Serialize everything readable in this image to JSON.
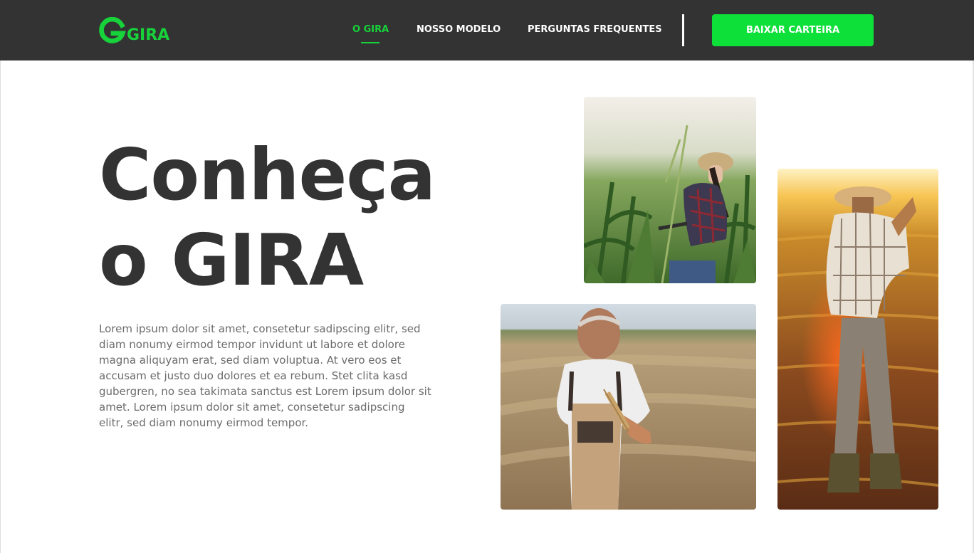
{
  "header": {
    "logo_text": "GIRA",
    "nav": [
      {
        "label": "O GIRA",
        "active": true
      },
      {
        "label": "NOSSO MODELO",
        "active": false
      },
      {
        "label": "PERGUNTAS FREQUENTES",
        "active": false
      }
    ],
    "cta_label": "BAIXAR CARTEIRA"
  },
  "hero": {
    "title_line1": "Conheça",
    "title_line2": "o GIRA",
    "body": "Lorem ipsum dolor sit amet, consetetur sadipscing elitr, sed diam nonumy eirmod tempor invidunt ut labore et dolore magna aliquyam erat, sed diam voluptua. At vero eos et accusam et justo duo dolores et ea rebum. Stet clita kasd gubergren, no sea takimata sanctus est Lorem ipsum dolor sit amet. Lorem ipsum dolor sit amet, consetetur sadipscing elitr, sed diam nonumy eirmod tempor."
  },
  "photos": [
    {
      "name": "woman-in-cornfield-photo"
    },
    {
      "name": "farmer-holding-wheat-photo"
    },
    {
      "name": "farmer-at-sunset-field-photo"
    }
  ],
  "colors": {
    "header_bg": "#333333",
    "accent": "#17d23a",
    "cta_bg": "#0ee03a",
    "title": "#333333",
    "body_text": "#6b6b6b"
  }
}
